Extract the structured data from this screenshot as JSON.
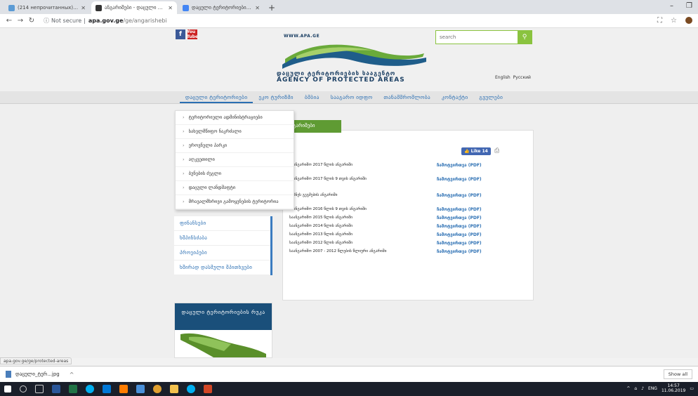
{
  "browser": {
    "tabs": [
      {
        "title": "(214 непрочитанных) — liko_sc",
        "fav": "#5b9bd5",
        "active": false
      },
      {
        "title": "ანგარიშები - დაცული ტერი",
        "fav": "#333333",
        "active": true
      },
      {
        "title": "დაცული ტერიტორიების სა",
        "fav": "#4285f4",
        "active": false
      }
    ],
    "new_tab": "+",
    "window_controls": [
      "–",
      "❐",
      "✕"
    ],
    "secure_label": "Not secure",
    "url_host": "apa.gov.ge",
    "url_path": "/ge/angarishebi"
  },
  "header": {
    "facebook": "f",
    "youtube": "You Tube",
    "site_url": "WWW.APA.GE",
    "geo_name": "დაცული ტერიტორიების სააგენტო",
    "eng_name": "AGENCY OF PROTECTED AREAS",
    "search_placeholder": "search",
    "lang_en": "English",
    "lang_ru": "Русский"
  },
  "nav": [
    "დაცული ტერიტორიები",
    "ეკო ტურიზმი",
    "ბმბია",
    "სააგარო იდფო",
    "თანამშრომლობა",
    "კონტაქტი",
    "გვულები"
  ],
  "dropdown": [
    "ტერიტორიული ადმინისტრაციები",
    "სახელმწიფო ნაკრძალი",
    "ეროვნული პარკი",
    "აღკვეთილი",
    "ბუნების ძეგლი",
    "დაცული ლანდშაფტი",
    "მრავალმხრივი გამოყენების ტერიტორია"
  ],
  "sidebar": [
    "ფინანსები",
    "ხშპინსძაბა",
    "პროეიპები",
    "ხშირად დასმული შპითხვები"
  ],
  "map_title": "დაცული ტერიტორიების რუკა",
  "content": {
    "tab_label": "ანგარიშები",
    "like_label": "Like 14",
    "reports": [
      {
        "title": "საანგარიშო 2017 წლის ანგარიში",
        "download": "ჩამოტვირთვა (PDF)"
      },
      {
        "title": "საანგარიშო 2017 წლის 9 თვის ანგარიში",
        "download": "ჩამოტვირთვა (PDF)"
      },
      {
        "title": "ბიზნეს გეგმების ანგარიში",
        "download": "ჩამოტვირთვა (PDF)"
      },
      {
        "title": "საანგარიშო 2016 წლის 9 თვის ანგარიში",
        "download": "ჩამოტვირთვა (PDF)"
      },
      {
        "title": "საანგარიშო 2015 წლის ანგარიში",
        "download": "ჩამოტვირთვა (PDF)"
      },
      {
        "title": "საანგარიშო 2014 წლის ანგარიში",
        "download": "ჩამოტვირთვა (PDF)"
      },
      {
        "title": "საანგარიშო 2013 წლის ანგარიში",
        "download": "ჩამოტვირთვა (PDF)"
      },
      {
        "title": "საანგარიშო 2012 წლის ანგარიში",
        "download": "ჩამოტვირთვა (PDF)"
      },
      {
        "title": "საანგარიშო 2007 - 2012 წლების წლიური ანგარიში",
        "download": "ჩამოტვირთვა (PDF)"
      }
    ]
  },
  "status_url": "apa.gov.ge/ge/protected-areas",
  "download": {
    "file": "დაცული_ტერ...jpg",
    "show_all": "Show all"
  },
  "tray": {
    "lang": "ENG",
    "time": "14:57",
    "date": "11.06.2019"
  }
}
